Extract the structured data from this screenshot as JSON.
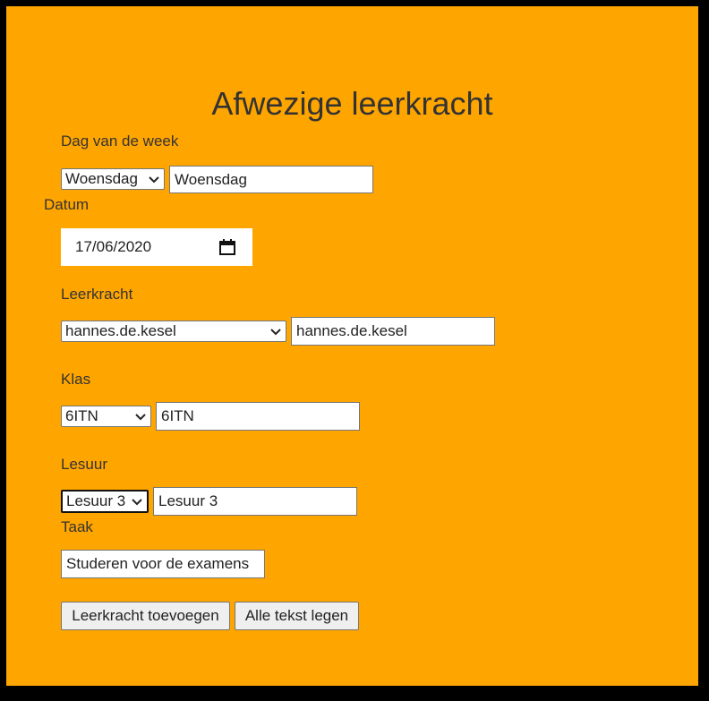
{
  "page": {
    "title": "Afwezige leerkracht",
    "background": "#ffa500"
  },
  "day": {
    "label": "Dag van de week",
    "selected": "Woensdag",
    "value": "Woensdag"
  },
  "date": {
    "label": "Datum",
    "value": "17/06/2020"
  },
  "teacher": {
    "label": "Leerkracht",
    "selected": "hannes.de.kesel",
    "value": "hannes.de.kesel"
  },
  "class": {
    "label": "Klas",
    "selected": "6ITN",
    "value": "6ITN"
  },
  "period": {
    "label": "Lesuur",
    "selected": "Lesuur 3",
    "value": "Lesuur 3"
  },
  "task": {
    "label": "Taak",
    "value": "Studeren voor de examens"
  },
  "buttons": {
    "add": "Leerkracht toevoegen",
    "clear": "Alle tekst legen"
  }
}
